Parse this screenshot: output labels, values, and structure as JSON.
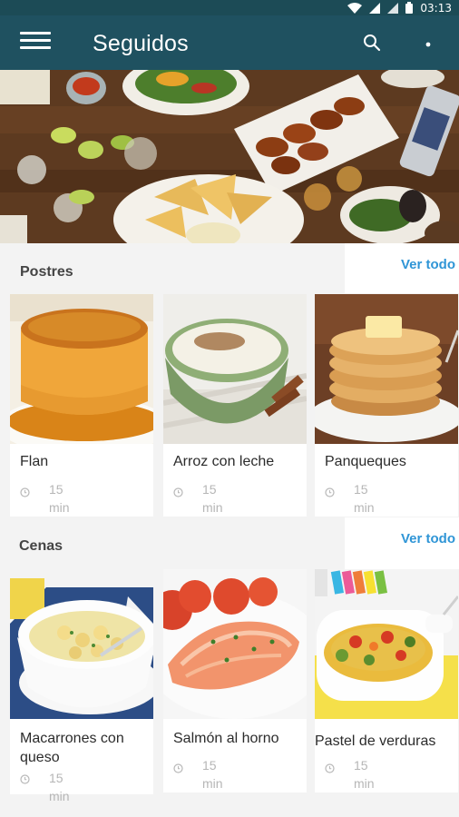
{
  "status_bar": {
    "time": "03:13"
  },
  "app_bar": {
    "title": "Seguidos"
  },
  "sections": [
    {
      "title": "Postres",
      "see_all": "Ver todo",
      "recipes": [
        {
          "name": "Flan",
          "time_value": "15",
          "time_unit": "min"
        },
        {
          "name": "Arroz con leche",
          "time_value": "15",
          "time_unit": "min"
        },
        {
          "name": "Panqueques",
          "time_value": "15",
          "time_unit": "min"
        }
      ]
    },
    {
      "title": "Cenas",
      "see_all": "Ver todo",
      "recipes": [
        {
          "name": "Macarrones con queso",
          "time_value": "15",
          "time_unit": "min"
        },
        {
          "name": "Salmón al horno",
          "time_value": "15",
          "time_unit": "min"
        },
        {
          "name": "Pastel de verduras",
          "time_value": "15",
          "time_unit": "min"
        }
      ]
    }
  ],
  "icons": {
    "menu": "menu-icon",
    "search": "search-icon",
    "overflow": "more-vert-icon",
    "time": "clock-icon",
    "wifi": "wifi-icon",
    "signal": "signal-icon",
    "battery": "battery-icon"
  },
  "colors": {
    "app_bar": "#1f5160",
    "status_bar": "#1c4b56",
    "link": "#2f95d6",
    "background": "#f3f3f3"
  }
}
